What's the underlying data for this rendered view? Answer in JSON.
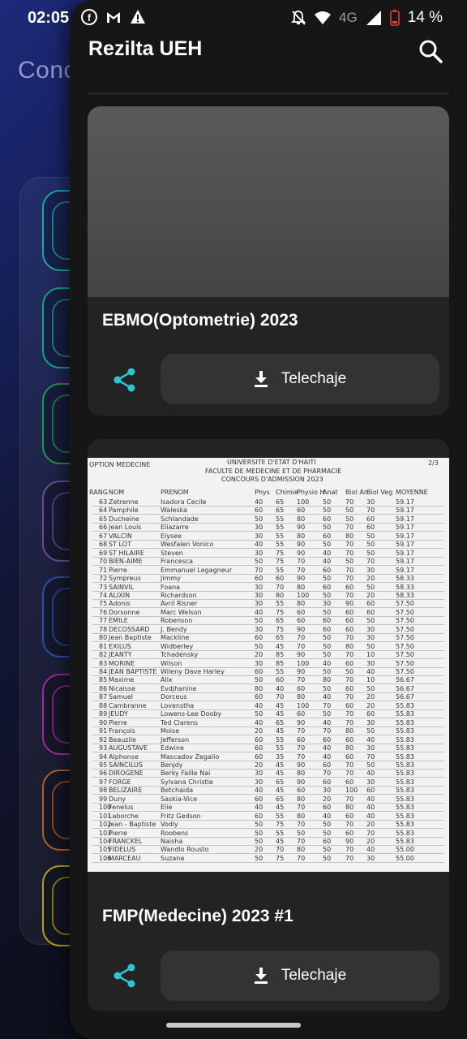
{
  "status_bar": {
    "time": "02:05",
    "network": "4G",
    "battery": "14 %"
  },
  "background_app": {
    "title": "Conc"
  },
  "app": {
    "title": "Rezilta UEH"
  },
  "cards": [
    {
      "title": "EBMO(Optometrie) 2023",
      "download_label": "Telechaje"
    },
    {
      "title": "FMP(Medecine) 2023 #1",
      "download_label": "Telechaje",
      "document": {
        "header_left": "OPTION MEDECINE",
        "header_center_1": "UNIVERSITE D'ETAT D'HAITI",
        "header_center_2": "FACULTE DE MEDECINE ET DE PHARMACIE",
        "header_center_3": "CONCOURS D'ADMISSION 2023",
        "page": "2/3",
        "columns": [
          "RANG",
          "NOM",
          "PRENOM",
          "Phys",
          "Chimie",
          "Physio H",
          "Anat",
          "Biol An",
          "Biol Veg",
          "MOYENNE"
        ],
        "rows": [
          [
            "63",
            "Zetrenne",
            "Isadora Cecile",
            "40",
            "65",
            "100",
            "50",
            "70",
            "30",
            "59.17"
          ],
          [
            "64",
            "Pamphile",
            "Waleska",
            "60",
            "65",
            "60",
            "50",
            "50",
            "70",
            "59.17"
          ],
          [
            "65",
            "Ducheine",
            "Schlandade",
            "50",
            "55",
            "80",
            "60",
            "50",
            "60",
            "59.17"
          ],
          [
            "66",
            "Jean Louis",
            "Eliazarre",
            "30",
            "55",
            "90",
            "50",
            "70",
            "60",
            "59.17"
          ],
          [
            "67",
            "VALCIN",
            "Elysee",
            "30",
            "55",
            "80",
            "60",
            "80",
            "50",
            "59.17"
          ],
          [
            "68",
            "ST LOT",
            "Wesfalen Vonico",
            "40",
            "55",
            "90",
            "50",
            "70",
            "50",
            "59.17"
          ],
          [
            "69",
            "ST HILAIRE",
            "Steven",
            "30",
            "75",
            "90",
            "40",
            "70",
            "50",
            "59.17"
          ],
          [
            "70",
            "BIEN-AIME",
            "Francesca",
            "50",
            "75",
            "70",
            "40",
            "50",
            "70",
            "59.17"
          ],
          [
            "71",
            "Pierre",
            "Emmanuel Legagneur",
            "70",
            "55",
            "70",
            "60",
            "70",
            "30",
            "59.17"
          ],
          [
            "72",
            "Sympreus",
            "Jimmy",
            "60",
            "60",
            "90",
            "50",
            "70",
            "20",
            "58.33"
          ],
          [
            "73",
            "SAINVIL",
            "Foana",
            "30",
            "70",
            "80",
            "60",
            "60",
            "50",
            "58.33"
          ],
          [
            "74",
            "ALIXIN",
            "Richardson",
            "30",
            "80",
            "100",
            "50",
            "70",
            "20",
            "58.33"
          ],
          [
            "75",
            "Adonis",
            "Avril Risner",
            "30",
            "55",
            "80",
            "30",
            "90",
            "60",
            "57.50"
          ],
          [
            "76",
            "Dorsonne",
            "Marc Welson",
            "40",
            "75",
            "60",
            "50",
            "60",
            "60",
            "57.50"
          ],
          [
            "77",
            "EMILE",
            "Robenson",
            "50",
            "65",
            "60",
            "60",
            "60",
            "50",
            "57.50"
          ],
          [
            "78",
            "DECOSSARD",
            "J. Bendy",
            "30",
            "75",
            "90",
            "60",
            "60",
            "30",
            "57.50"
          ],
          [
            "80",
            "Jean Baptiste",
            "Mackline",
            "60",
            "65",
            "70",
            "50",
            "70",
            "30",
            "57.50"
          ],
          [
            "81",
            "EXILUS",
            "Widberley",
            "50",
            "45",
            "70",
            "50",
            "80",
            "50",
            "57.50"
          ],
          [
            "82",
            "JEANTY",
            "Tchadensky",
            "20",
            "85",
            "90",
            "50",
            "70",
            "10",
            "57.50"
          ],
          [
            "83",
            "MORINE",
            "Wilson",
            "30",
            "85",
            "100",
            "40",
            "60",
            "30",
            "57.50"
          ],
          [
            "84",
            "JEAN BAPTISTE",
            "Wileny Dave Harley",
            "60",
            "55",
            "90",
            "50",
            "50",
            "40",
            "57.50"
          ],
          [
            "85",
            "Maxime",
            "Alix",
            "50",
            "60",
            "70",
            "80",
            "70",
            "10",
            "56.67"
          ],
          [
            "86",
            "Nicaisse",
            "Evdjhanine",
            "80",
            "40",
            "60",
            "50",
            "60",
            "50",
            "56.67"
          ],
          [
            "87",
            "Samuel",
            "Dorceus",
            "60",
            "70",
            "80",
            "40",
            "70",
            "20",
            "56.67"
          ],
          [
            "88",
            "Cambranne",
            "Lovenstha",
            "40",
            "45",
            "100",
            "70",
            "60",
            "20",
            "55.83"
          ],
          [
            "89",
            "JEUDY",
            "Lowens-Lee Dooby",
            "50",
            "45",
            "60",
            "50",
            "70",
            "60",
            "55.83"
          ],
          [
            "90",
            "Pierre",
            "Ted Clarens",
            "40",
            "65",
            "90",
            "40",
            "70",
            "30",
            "55.83"
          ],
          [
            "91",
            "François",
            "Moise",
            "20",
            "45",
            "70",
            "70",
            "80",
            "50",
            "55.83"
          ],
          [
            "92",
            "Beauzile",
            "Jefferson",
            "60",
            "55",
            "60",
            "60",
            "60",
            "40",
            "55.83"
          ],
          [
            "93",
            "AUGUSTAVE",
            "Edwine",
            "60",
            "55",
            "70",
            "40",
            "80",
            "30",
            "55.83"
          ],
          [
            "94",
            "Alphonse",
            "Mascadov Zegalio",
            "60",
            "35",
            "70",
            "40",
            "60",
            "70",
            "55.83"
          ],
          [
            "95",
            "SAINCILUS",
            "Benjdy",
            "20",
            "45",
            "90",
            "60",
            "70",
            "50",
            "55.83"
          ],
          [
            "96",
            "DIROGENE",
            "Berky Faille Nai",
            "30",
            "45",
            "80",
            "70",
            "70",
            "40",
            "55.83"
          ],
          [
            "97",
            "FORGE",
            "Sylvana Christie",
            "30",
            "65",
            "90",
            "60",
            "60",
            "30",
            "55.83"
          ],
          [
            "98",
            "BELIZAIRE",
            "Betchaida",
            "40",
            "45",
            "60",
            "30",
            "100",
            "60",
            "55.83"
          ],
          [
            "99",
            "Duny",
            "Saskia-Vice",
            "60",
            "65",
            "80",
            "20",
            "70",
            "40",
            "55.83"
          ],
          [
            "100",
            "Fenelus",
            "Elie",
            "40",
            "45",
            "70",
            "60",
            "80",
            "40",
            "55.83"
          ],
          [
            "101",
            "Laborche",
            "Fritz Gedson",
            "60",
            "55",
            "80",
            "40",
            "60",
            "40",
            "55.83"
          ],
          [
            "102",
            "Jean - Baptiste",
            "Vodly",
            "50",
            "75",
            "70",
            "50",
            "70",
            "20",
            "55.83"
          ],
          [
            "103",
            "Pierre",
            "Roobens",
            "50",
            "55",
            "50",
            "50",
            "60",
            "70",
            "55.83"
          ],
          [
            "104",
            "FRANCKEL",
            "Naisha",
            "50",
            "45",
            "70",
            "60",
            "90",
            "20",
            "55.83"
          ],
          [
            "105",
            "FIDELUS",
            "Wandlo Rousto",
            "20",
            "70",
            "80",
            "50",
            "70",
            "40",
            "55.00"
          ],
          [
            "106",
            "MARCEAU",
            "Suzana",
            "50",
            "75",
            "70",
            "50",
            "70",
            "30",
            "55.00"
          ]
        ]
      }
    }
  ]
}
